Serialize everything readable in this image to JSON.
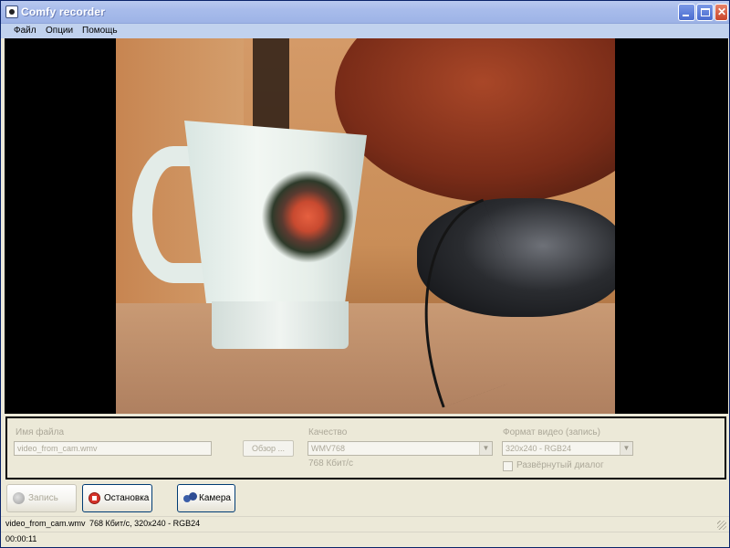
{
  "window": {
    "title": "Comfy recorder",
    "controls": {
      "minimize": "minimize",
      "maximize": "maximize",
      "close": "✕"
    }
  },
  "menu": {
    "items": [
      "Файл",
      "Опции",
      "Помощь"
    ]
  },
  "video": {
    "description_icon": "webcam-preview"
  },
  "settings": {
    "filename_label": "Имя файла",
    "filename_value": "video_from_cam.wmv",
    "browse_label": "Обзор ...",
    "quality_label": "Качество",
    "quality_value": "WMV768",
    "quality_bitrate": "768 Кбит/с",
    "format_label": "Формат видео (запись)",
    "format_value": "320x240 - RGB24",
    "expanded_dialog_label": "Развёрнутый диалог",
    "expanded_dialog_checked": false
  },
  "actions": {
    "record_label": "Запись",
    "stop_label": "Остановка",
    "camera_label": "Камера"
  },
  "status": {
    "file": "video_from_cam.wmv",
    "info": "768 Кбит/с, 320x240 - RGB24",
    "elapsed": "00:00:11"
  }
}
